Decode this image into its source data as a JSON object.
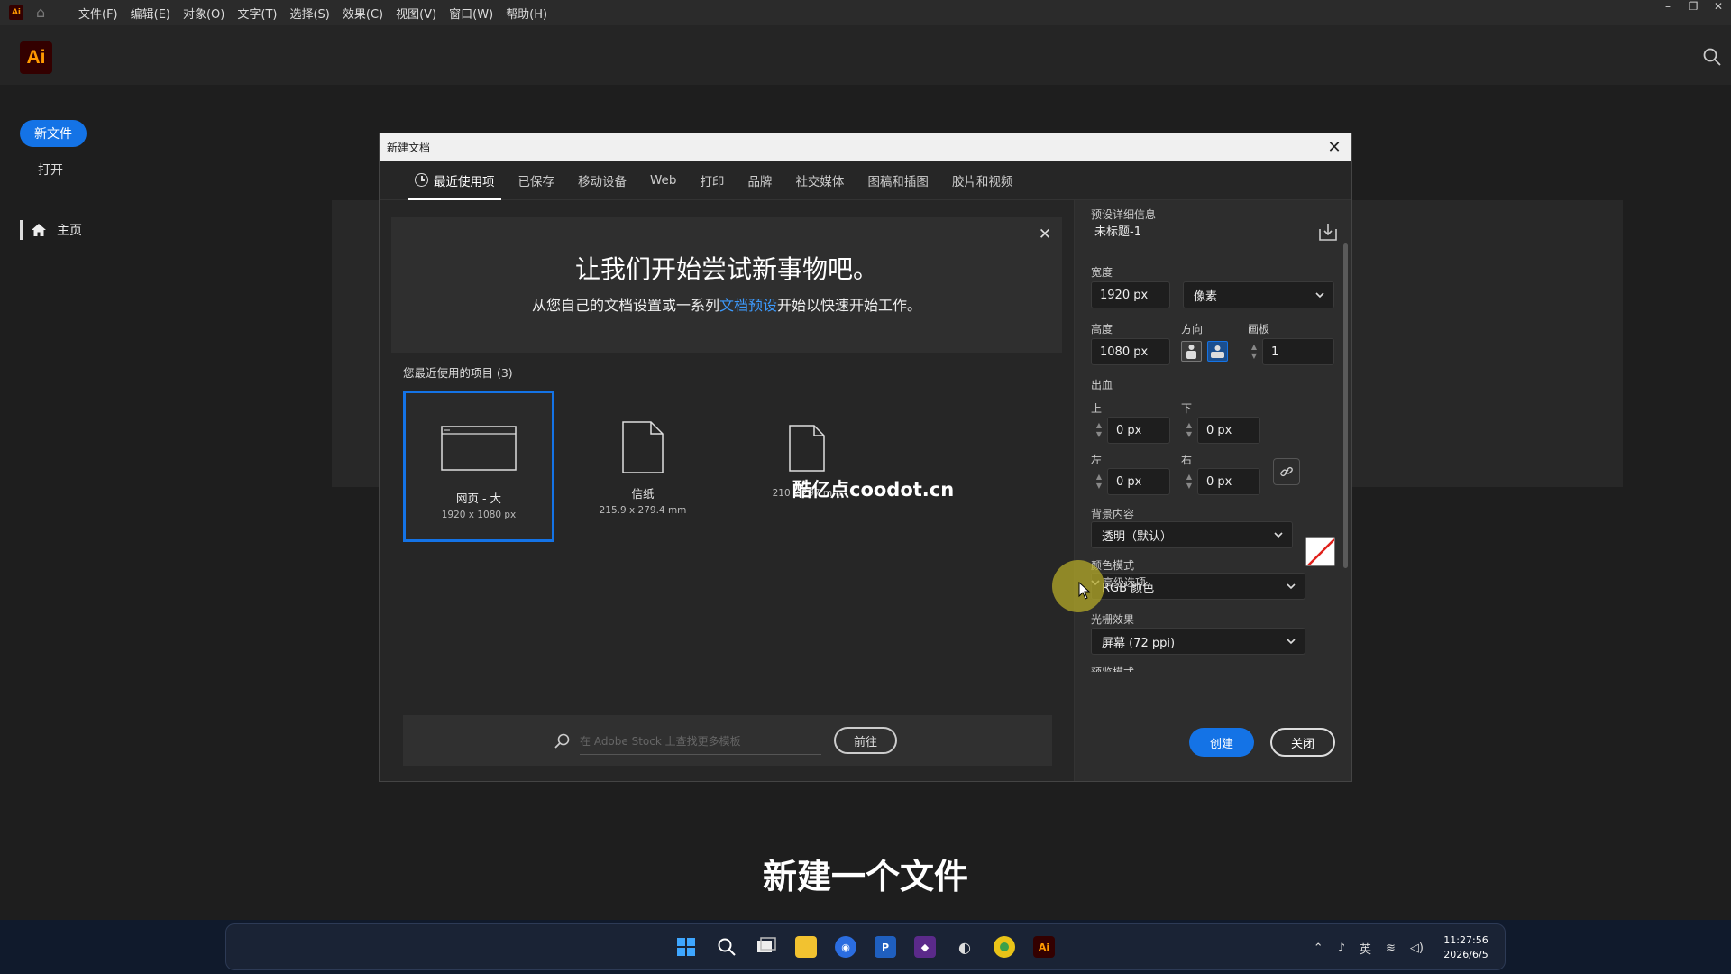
{
  "menubar": {
    "logo": "Ai",
    "items": [
      "文件(F)",
      "编辑(E)",
      "对象(O)",
      "文字(T)",
      "选择(S)",
      "效果(C)",
      "视图(V)",
      "窗口(W)",
      "帮助(H)"
    ]
  },
  "app": {
    "logo_text": "Ai",
    "brand_color": "#ff9a00",
    "accent": "#1473e6"
  },
  "sidebar": {
    "new_file": "新文件",
    "open": "打开",
    "home": "主页"
  },
  "dialog": {
    "title": "新建文档",
    "tabs": [
      "最近使用项",
      "已保存",
      "移动设备",
      "Web",
      "打印",
      "品牌",
      "社交媒体",
      "图稿和插图",
      "胶片和视频"
    ],
    "welcome": {
      "title": "让我们开始尝试新事物吧。",
      "sub_before": "从您自己的文档设置或一系列",
      "sub_link": "文档预设",
      "sub_after": "开始以快速开始工作。"
    },
    "recent_label": "您最近使用的项目 (3)",
    "recent": [
      {
        "name": "网页 - 大",
        "size": "1920 x 1080 px"
      },
      {
        "name": "信纸",
        "size": "215.9 x 279.4 mm"
      },
      {
        "name": "",
        "size": "210 x 297 mm"
      }
    ],
    "watermark": "酷亿点coodot.cn",
    "stock": {
      "placeholder": "在 Adobe Stock 上查找更多模板",
      "go": "前往"
    },
    "preset": {
      "section": "预设详细信息",
      "name": "未标题-1",
      "width_label": "宽度",
      "width": "1920 px",
      "unit": "像素",
      "height_label": "高度",
      "height": "1080 px",
      "orientation_label": "方向",
      "artboards_label": "画板",
      "artboards": "1",
      "bleed_label": "出血",
      "top_label": "上",
      "top": "0 px",
      "bottom_label": "下",
      "bottom": "0 px",
      "left_label": "左",
      "left": "0 px",
      "right_label": "右",
      "right": "0 px",
      "bg_label": "背景内容",
      "bg_value": "透明（默认）",
      "advanced": "高级选项",
      "color_mode_label": "颜色模式",
      "color_mode": "RGB 颜色",
      "raster_label": "光栅效果",
      "raster": "屏幕 (72 ppi)",
      "preview_label": "预览模式"
    },
    "create": "创建",
    "close": "关闭"
  },
  "subtitle": "新建一个文件",
  "taskbar": {
    "time": "11:27:56",
    "date": "2026/6/5",
    "ime": "英",
    "icons": [
      "windows-start-icon",
      "search-icon",
      "task-view-icon",
      "file-explorer-icon",
      "browser-icon",
      "p-app-icon",
      "visual-studio-icon",
      "audio-app-icon",
      "chrome-icon",
      "illustrator-icon"
    ]
  }
}
